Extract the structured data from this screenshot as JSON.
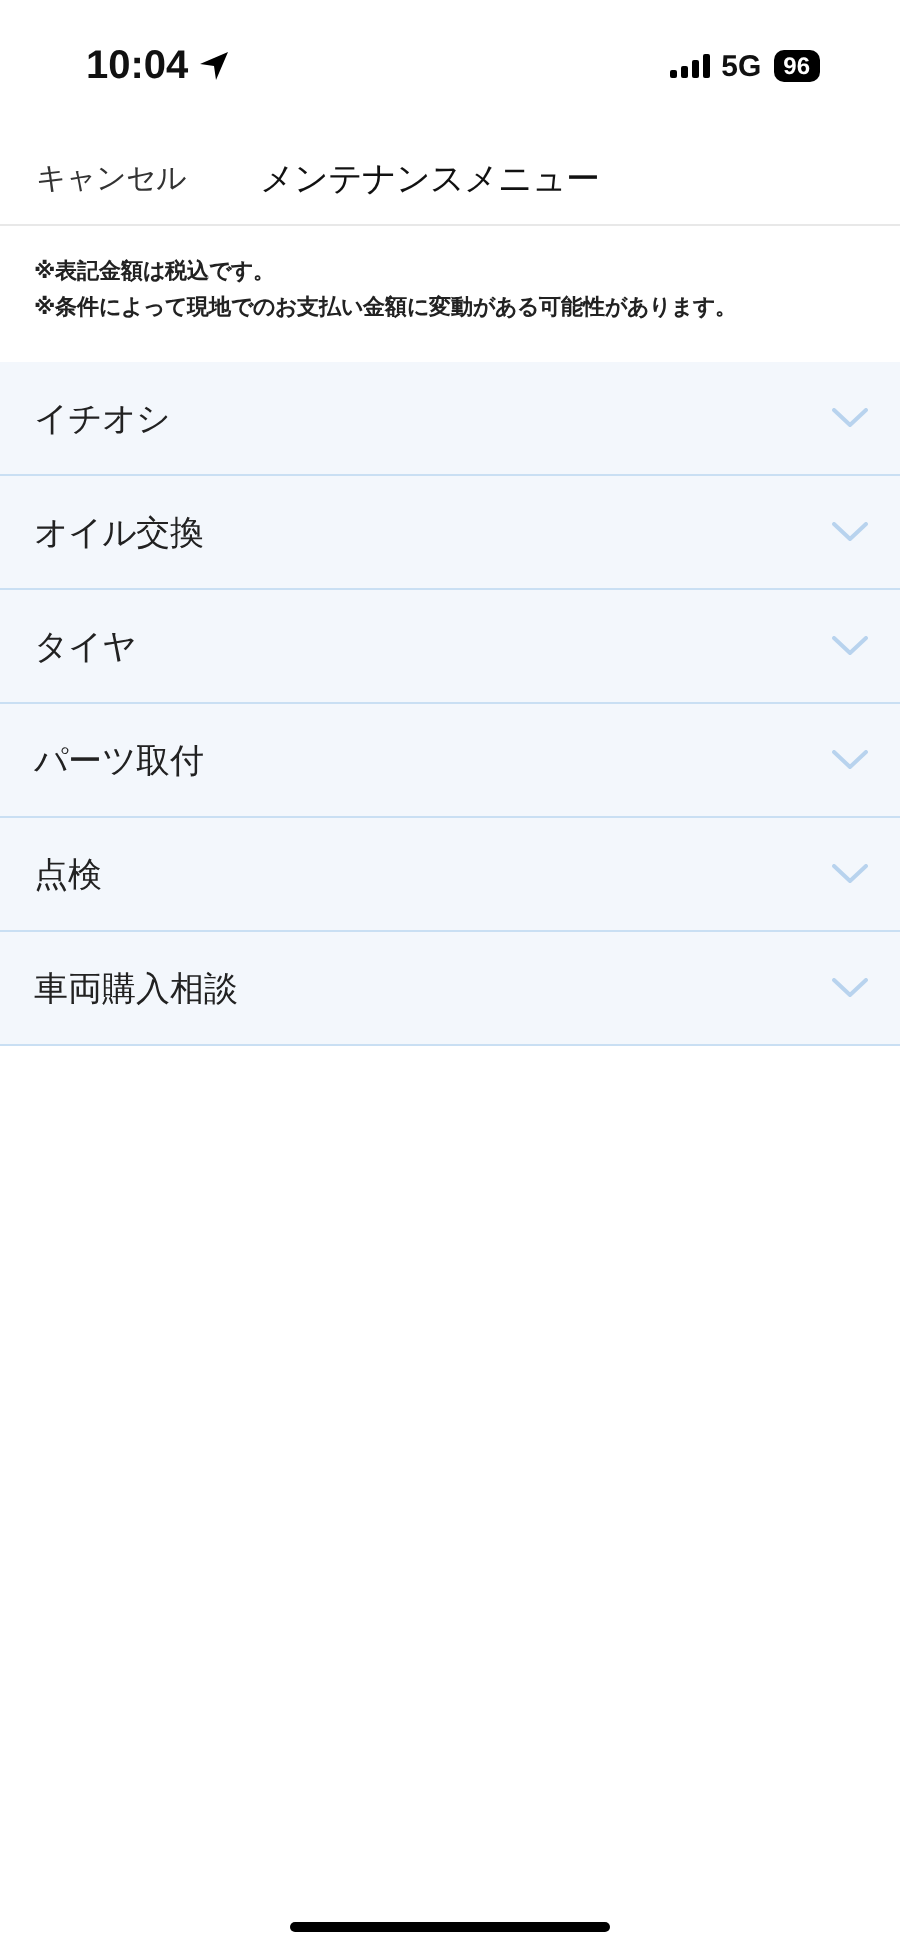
{
  "status_bar": {
    "time": "10:04",
    "network": "5G",
    "battery": "96"
  },
  "nav": {
    "cancel": "キャンセル",
    "title": "メンテナンスメニュー"
  },
  "notes": [
    "※表記金額は税込です。",
    "※条件によって現地でのお支払い金額に変動がある可能性があります。"
  ],
  "menu": [
    {
      "label": "イチオシ",
      "expanded": false
    },
    {
      "label": "オイル交換",
      "expanded": false
    },
    {
      "label": "タイヤ",
      "expanded": false
    },
    {
      "label": "パーツ取付",
      "expanded": false
    },
    {
      "label": "点検",
      "expanded": false
    },
    {
      "label": "車両購入相談",
      "expanded": false
    }
  ]
}
